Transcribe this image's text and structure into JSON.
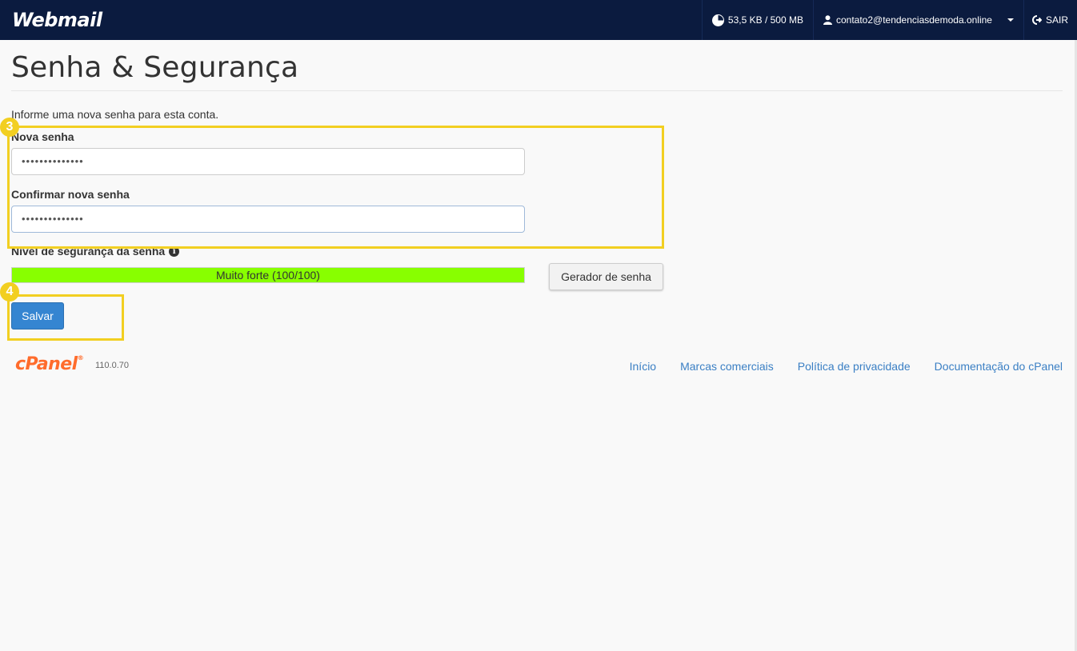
{
  "app": {
    "logo_text": "Webmail"
  },
  "topbar": {
    "quota": "53,5 KB / 500 MB",
    "user_email": "contato2@tendenciasdemoda.online",
    "logout_label": "SAIR"
  },
  "page": {
    "title": "Senha & Segurança",
    "intro": "Informe uma nova senha para esta conta."
  },
  "form": {
    "new_password_label": "Nova senha",
    "new_password_value": "••••••••••••••",
    "confirm_password_label": "Confirmar nova senha",
    "confirm_password_value": "••••••••••••••",
    "strength_label": "Nível de segurança da senha",
    "strength_text": "Muito forte (100/100)",
    "strength_score": 100,
    "strength_max": 100,
    "strength_color": "#88ff00",
    "generator_button": "Gerador de senha",
    "save_button": "Salvar"
  },
  "callouts": {
    "step3": "3",
    "step4": "4",
    "color": "#f2cf21"
  },
  "footer": {
    "brand": "cPanel",
    "version": "110.0.70",
    "links": [
      "Início",
      "Marcas comerciais",
      "Política de privacidade",
      "Documentação do cPanel"
    ]
  }
}
